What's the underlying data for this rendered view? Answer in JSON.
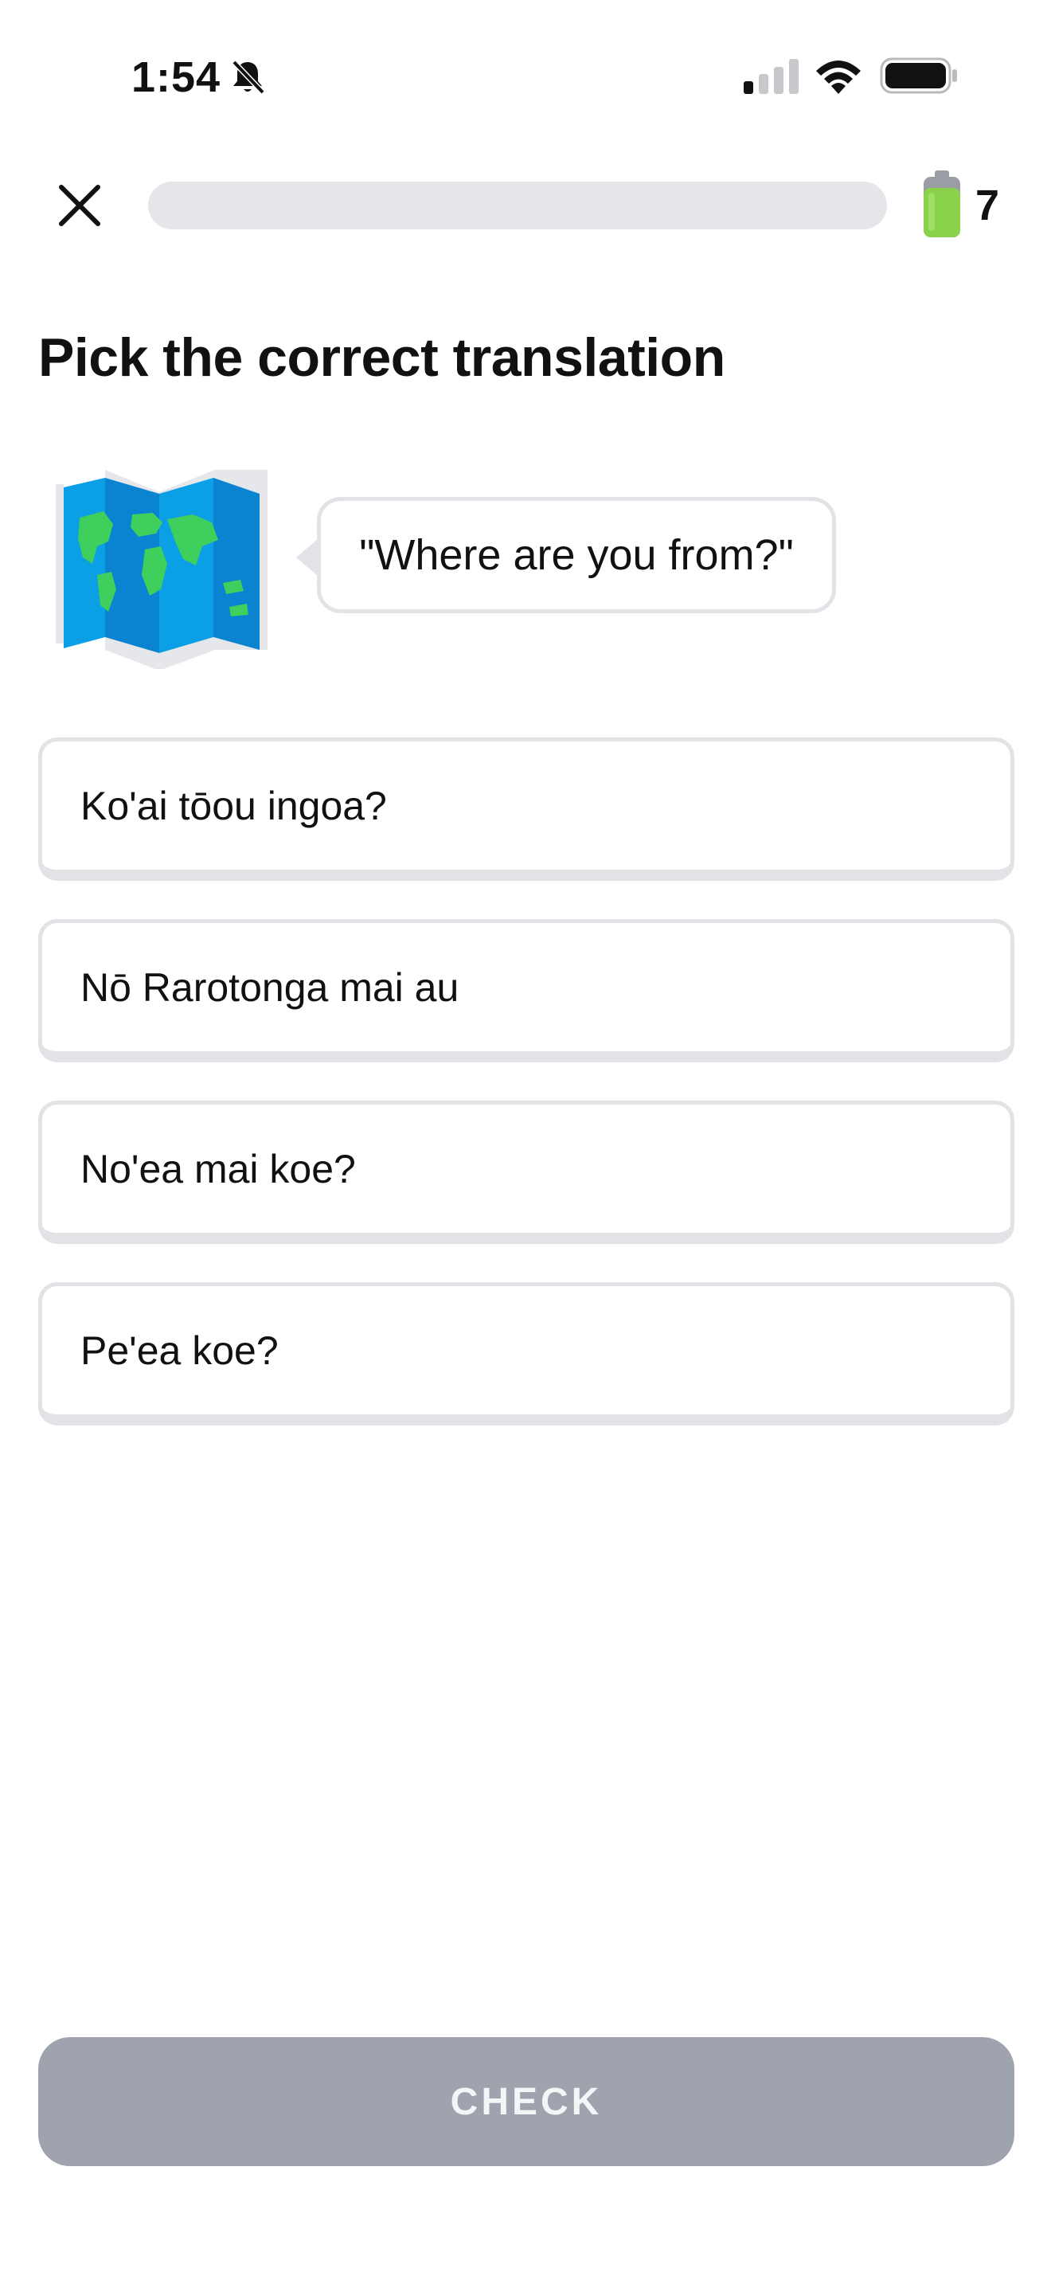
{
  "status_bar": {
    "time": "1:54",
    "icons": [
      "bell-slash-icon",
      "cellular-signal-icon",
      "wifi-icon",
      "battery-icon"
    ]
  },
  "header": {
    "close_icon": "close-icon",
    "progress_fraction": 0,
    "energy_icon": "energy-battery-icon",
    "energy_count": "7"
  },
  "prompt": {
    "title": "Pick the correct translation",
    "illustration": "world-map-icon",
    "phrase": "\"Where are you from?\""
  },
  "options": [
    {
      "label": "Ko'ai tōou ingoa?"
    },
    {
      "label": "Nō Rarotonga mai au"
    },
    {
      "label": "No'ea mai koe?"
    },
    {
      "label": "Pe'ea koe?"
    }
  ],
  "footer": {
    "check_label": "CHECK"
  },
  "colors": {
    "progress_track": "#e5e6ea",
    "option_border": "#e2e3e7",
    "check_button_disabled": "#9ea3ad",
    "energy_green": "#8ad24a",
    "map_blue": "#0ea5e9",
    "map_land": "#3ecf5c"
  }
}
